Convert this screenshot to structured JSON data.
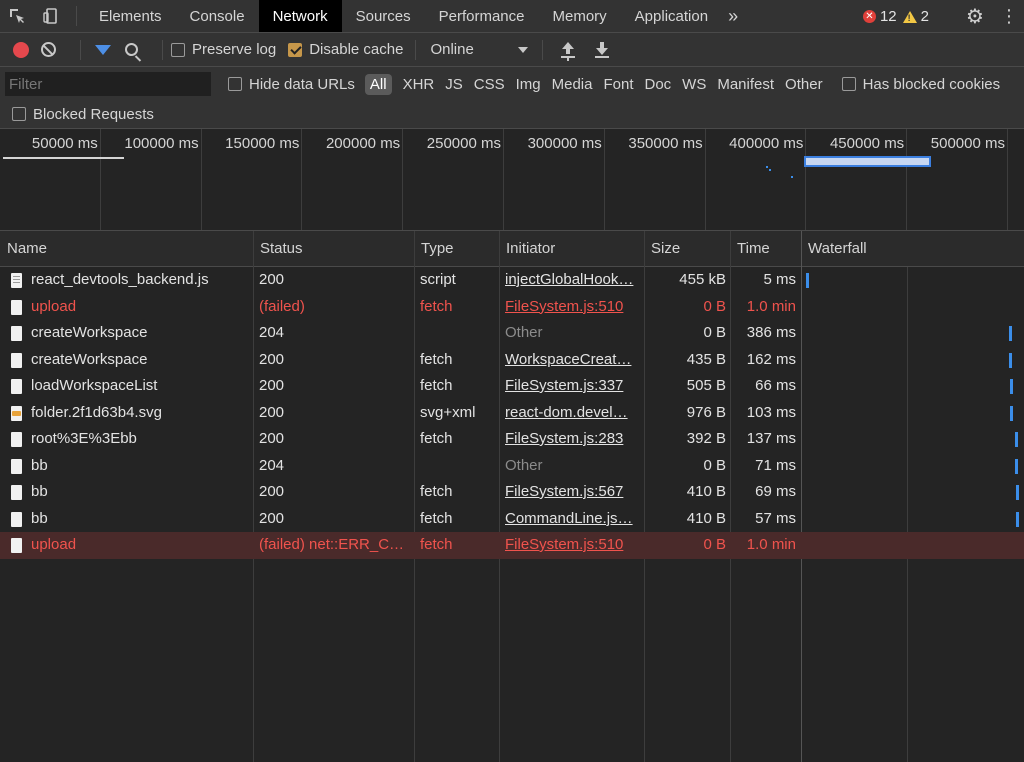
{
  "tabs": {
    "items": [
      "Elements",
      "Console",
      "Network",
      "Sources",
      "Performance",
      "Memory",
      "Application"
    ],
    "active": "Network",
    "more": "»",
    "error_count": "12",
    "warning_count": "2"
  },
  "toolbar": {
    "preserve_log": "Preserve log",
    "disable_cache": "Disable cache",
    "throttling": "Online"
  },
  "filter": {
    "placeholder": "Filter",
    "hide_data_urls": "Hide data URLs",
    "types": [
      "All",
      "XHR",
      "JS",
      "CSS",
      "Img",
      "Media",
      "Font",
      "Doc",
      "WS",
      "Manifest",
      "Other"
    ],
    "has_blocked_cookies": "Has blocked cookies",
    "blocked_requests": "Blocked Requests"
  },
  "overview": {
    "ticks": [
      "50000 ms",
      "100000 ms",
      "150000 ms",
      "200000 ms",
      "250000 ms",
      "300000 ms",
      "350000 ms",
      "400000 ms",
      "450000 ms",
      "500000 ms"
    ]
  },
  "table": {
    "headers": {
      "name": "Name",
      "status": "Status",
      "type": "Type",
      "initiator": "Initiator",
      "size": "Size",
      "time": "Time",
      "waterfall": "Waterfall"
    },
    "rows": [
      {
        "name": "react_devtools_backend.js",
        "status": "200",
        "type": "script",
        "initiator": "injectGlobalHook…",
        "size": "455 kB",
        "time": "5 ms"
      },
      {
        "name": "upload",
        "status": "(failed)",
        "type": "fetch",
        "initiator": "FileSystem.js:510",
        "size": "0 B",
        "time": "1.0 min"
      },
      {
        "name": "createWorkspace",
        "status": "204",
        "type": "",
        "initiator": "Other",
        "size": "0 B",
        "time": "386 ms"
      },
      {
        "name": "createWorkspace",
        "status": "200",
        "type": "fetch",
        "initiator": "WorkspaceCreat…",
        "size": "435 B",
        "time": "162 ms"
      },
      {
        "name": "loadWorkspaceList",
        "status": "200",
        "type": "fetch",
        "initiator": "FileSystem.js:337",
        "size": "505 B",
        "time": "66 ms"
      },
      {
        "name": "folder.2f1d63b4.svg",
        "status": "200",
        "type": "svg+xml",
        "initiator": "react-dom.devel…",
        "size": "976 B",
        "time": "103 ms"
      },
      {
        "name": "root%3E%3Ebb",
        "status": "200",
        "type": "fetch",
        "initiator": "FileSystem.js:283",
        "size": "392 B",
        "time": "137 ms"
      },
      {
        "name": "bb",
        "status": "204",
        "type": "",
        "initiator": "Other",
        "size": "0 B",
        "time": "71 ms"
      },
      {
        "name": "bb",
        "status": "200",
        "type": "fetch",
        "initiator": "FileSystem.js:567",
        "size": "410 B",
        "time": "69 ms"
      },
      {
        "name": "bb",
        "status": "200",
        "type": "fetch",
        "initiator": "CommandLine.js…",
        "size": "410 B",
        "time": "57 ms"
      },
      {
        "name": "upload",
        "status": "(failed) net::ERR_C…",
        "type": "fetch",
        "initiator": "FileSystem.js:510",
        "size": "0 B",
        "time": "1.0 min"
      }
    ]
  }
}
